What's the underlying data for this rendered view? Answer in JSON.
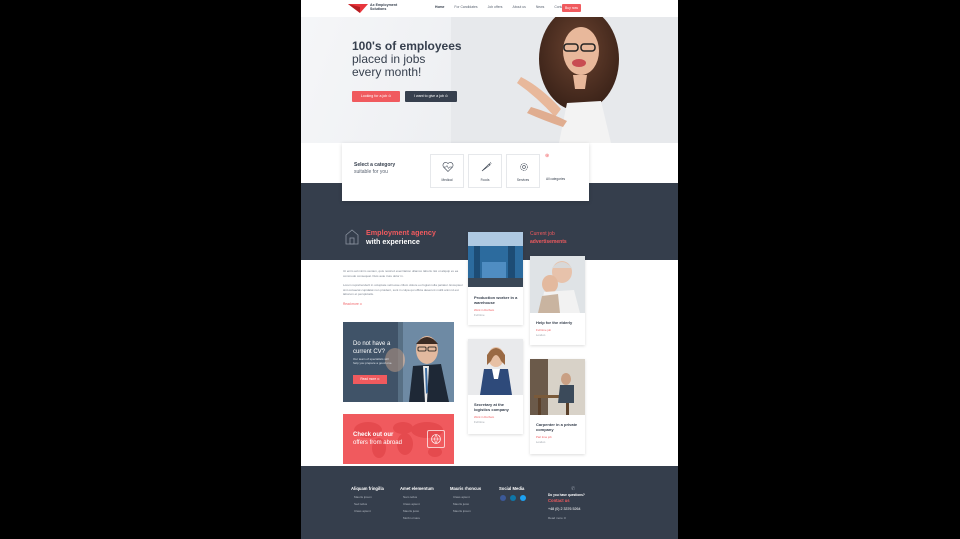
{
  "header": {
    "logo_text": "Ax Employment Solutions",
    "nav": [
      "Home",
      "For Candidates",
      "Job offers",
      "About us",
      "News",
      "Contact"
    ],
    "buy_label": "Buy now"
  },
  "hero": {
    "heading_bold": "100's of employees",
    "heading_rest": "placed in jobs every month!",
    "btn_look": "Looking for a job ⊙",
    "btn_give": "I want to give a job ⊙"
  },
  "category": {
    "title": "Select a category",
    "subtitle": "suitable for you",
    "items": [
      {
        "label": "Medical",
        "icon": "heart-pulse-icon"
      },
      {
        "label": "Foods",
        "icon": "carrot-icon"
      },
      {
        "label": "Services",
        "icon": "gear-icon"
      }
    ],
    "all_label": "All categories"
  },
  "agency": {
    "title_1": "Employment agency",
    "title_2": "with experience",
    "para_1": "Ut enim ad minim veniam, quis nostrud exercitation ullamco laboris nisi ut aliquip ex ea commodo consequat. Duis aute irure dolor in.",
    "para_2": "Lorem reprehenderit in voluptate velit esse cillum dolore eu fugiat nulla pariatur. Excepteur sint occaecat cupidatat non proident, sunt in culpa qui officia deserunt mollit anim id est laborum et perspiciatis.",
    "read_more": "Read more ⊙"
  },
  "cv_card": {
    "title": "Do not have a current CV?",
    "text": "Our team of specialists will help you prepare a good one.",
    "button": "Read more ⊙"
  },
  "abroad_card": {
    "title_1": "Check out our",
    "title_2": "offers from abroad"
  },
  "jobs": {
    "heading_1": "Current job",
    "heading_2": "advertisements",
    "items": [
      {
        "title": "Production worker in a warehouse",
        "meta": "Work in Durham",
        "meta2": "Full time"
      },
      {
        "title": "Help for the elderly",
        "meta": "Full time job",
        "meta2": "London"
      },
      {
        "title": "Secretary at the logistics company",
        "meta": "Work in Durham",
        "meta2": "Full time"
      },
      {
        "title": "Carpenter in a private company",
        "meta": "Part time job",
        "meta2": "London"
      }
    ]
  },
  "footer": {
    "cols": [
      {
        "title": "Aliquam fringilla",
        "items": [
          "Mauris ipsum",
          "Sed tellus",
          "Class aptent"
        ]
      },
      {
        "title": "Amet elementum",
        "items": [
          "Nam tellus",
          "Class aptent",
          "Mauris justo",
          "Morbi ornare"
        ]
      },
      {
        "title": "Mauris rhoncus",
        "items": [
          "Class aptent",
          "Mauris justo",
          "Mauris ipsum"
        ]
      }
    ],
    "social_title": "Social Media",
    "contact_q": "Do you have questions?",
    "contact_link": "Contact us",
    "phone": "+48 (0) 2 3376 5264",
    "read_more": "Read more ⊙"
  }
}
